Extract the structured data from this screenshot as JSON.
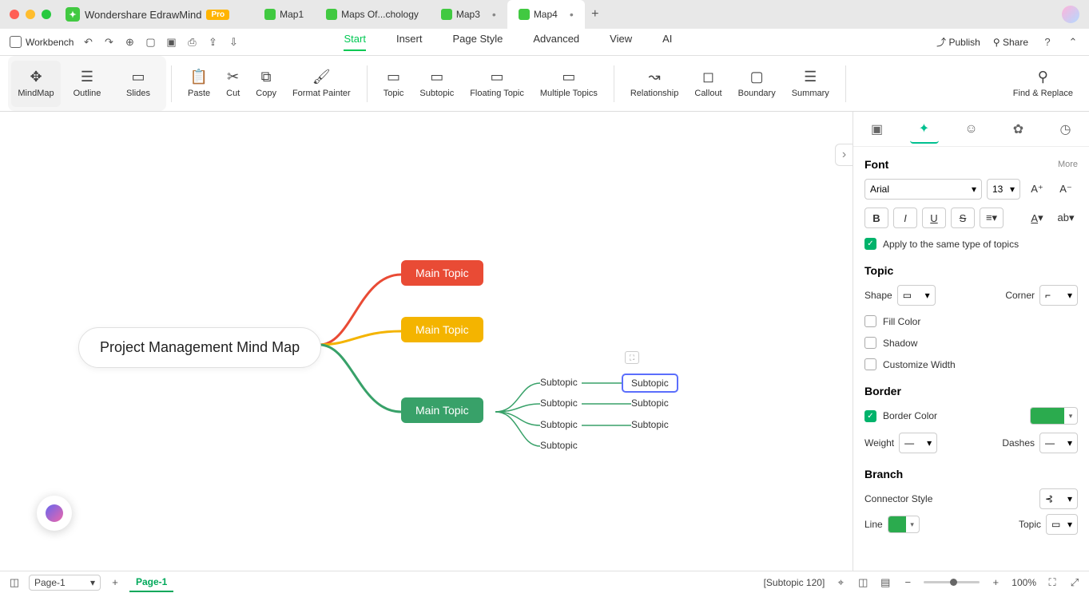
{
  "app": {
    "name": "Wondershare EdrawMind",
    "badge": "Pro"
  },
  "tabs": [
    {
      "label": "Map1"
    },
    {
      "label": "Maps Of...chology"
    },
    {
      "label": "Map3"
    },
    {
      "label": "Map4",
      "active": true
    }
  ],
  "menubar": {
    "workbench": "Workbench",
    "items": [
      "Start",
      "Insert",
      "Page Style",
      "Advanced",
      "View",
      "AI"
    ],
    "active": "Start",
    "publish": "Publish",
    "share": "Share"
  },
  "toolbar": {
    "views": [
      "MindMap",
      "Outline",
      "Slides"
    ],
    "active_view": "MindMap",
    "edit": [
      "Paste",
      "Cut",
      "Copy",
      "Format Painter"
    ],
    "topics": [
      "Topic",
      "Subtopic",
      "Floating Topic",
      "Multiple Topics"
    ],
    "extras": [
      "Relationship",
      "Callout",
      "Boundary",
      "Summary"
    ],
    "find": "Find & Replace"
  },
  "mindmap": {
    "central": "Project Management Mind Map",
    "mains": [
      "Main Topic",
      "Main Topic",
      "Main Topic"
    ],
    "subs_col1": [
      "Subtopic",
      "Subtopic",
      "Subtopic",
      "Subtopic"
    ],
    "subs_col2": [
      "Subtopic",
      "Subtopic",
      "Subtopic"
    ],
    "selected": "Subtopic"
  },
  "panel": {
    "font_title": "Font",
    "more": "More",
    "font_name": "Arial",
    "font_size": "13",
    "apply_same": "Apply to the same type of topics",
    "topic_title": "Topic",
    "shape": "Shape",
    "corner": "Corner",
    "fill": "Fill Color",
    "shadow": "Shadow",
    "custom_width": "Customize Width",
    "border_title": "Border",
    "border_color": "Border Color",
    "weight": "Weight",
    "dashes": "Dashes",
    "branch_title": "Branch",
    "connector": "Connector Style",
    "line": "Line",
    "topic_label": "Topic",
    "border_swatch": "#2bab4e"
  },
  "status": {
    "page_select": "Page-1",
    "page_tab": "Page-1",
    "selection": "[Subtopic 120]",
    "zoom": "100%"
  }
}
